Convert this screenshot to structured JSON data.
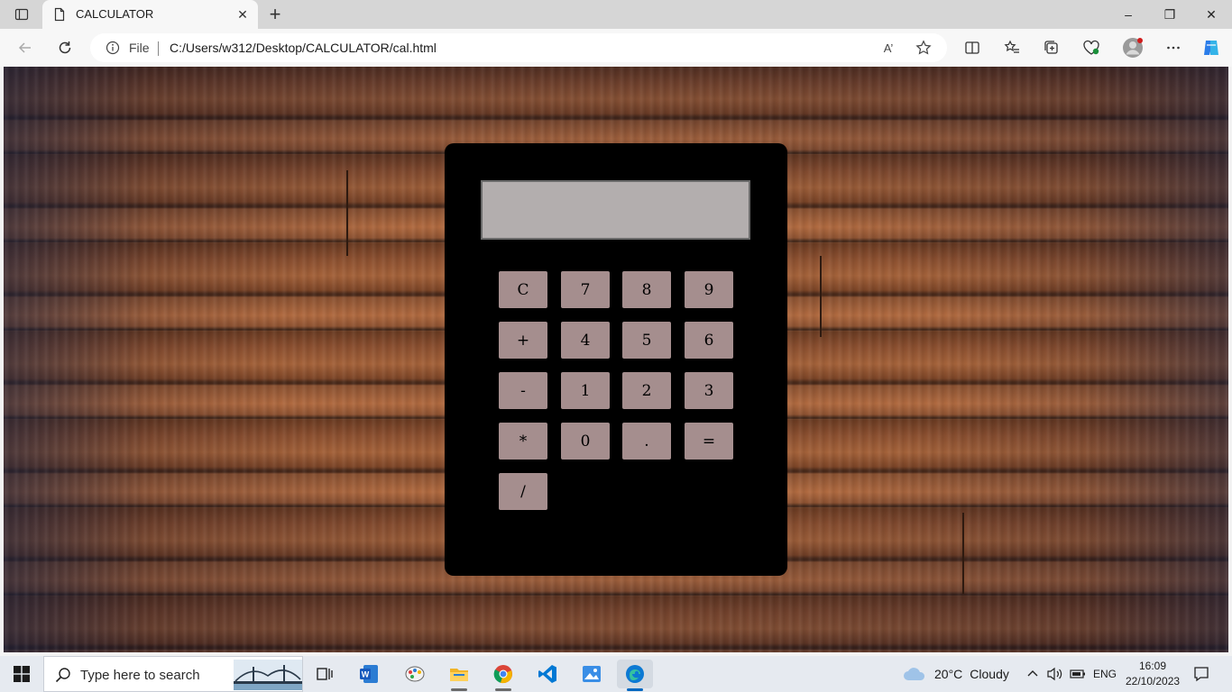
{
  "browser": {
    "tab": {
      "title": "CALCULATOR",
      "close_glyph": "✕"
    },
    "new_tab_glyph": "+",
    "window_controls": {
      "minimize": "–",
      "restore": "❐",
      "close": "✕"
    },
    "address": {
      "scheme_label": "File",
      "url": "C:/Users/w312/Desktop/CALCULATOR/cal.html"
    },
    "read_aloud_glyph": "A’"
  },
  "calculator": {
    "display_value": "",
    "buttons": [
      {
        "label": "C"
      },
      {
        "label": "7"
      },
      {
        "label": "8"
      },
      {
        "label": "9"
      },
      {
        "label": "+"
      },
      {
        "label": "4"
      },
      {
        "label": "5"
      },
      {
        "label": "6"
      },
      {
        "label": "-"
      },
      {
        "label": "1"
      },
      {
        "label": "2"
      },
      {
        "label": "3"
      },
      {
        "label": "*"
      },
      {
        "label": "0"
      },
      {
        "label": "."
      },
      {
        "label": "="
      },
      {
        "label": "/"
      }
    ]
  },
  "taskbar": {
    "search_placeholder": "Type here to search",
    "weather": {
      "temp": "20°C",
      "condition": "Cloudy"
    },
    "language": "ENG",
    "time": "16:09",
    "date": "22/10/2023"
  },
  "colors": {
    "calculator_body": "#000000",
    "display": "#b3aeae",
    "button": "#a58e8e"
  }
}
